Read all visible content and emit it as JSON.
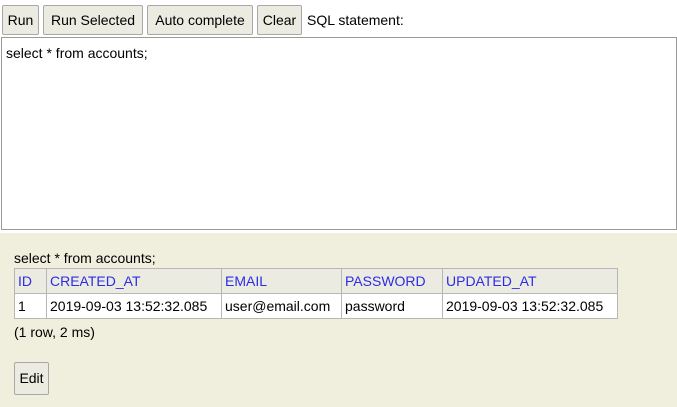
{
  "toolbar": {
    "run_label": "Run",
    "run_selected_label": "Run Selected",
    "auto_complete_label": "Auto complete",
    "clear_label": "Clear",
    "sql_statement_label": "SQL statement:"
  },
  "editor": {
    "sql_text": "select * from accounts;"
  },
  "results": {
    "query_echo": "select * from accounts;",
    "columns": [
      "ID",
      "CREATED_AT",
      "EMAIL",
      "PASSWORD",
      "UPDATED_AT"
    ],
    "rows": [
      [
        "1",
        "2019-09-03 13:52:32.085",
        "user@email.com",
        "password",
        "2019-09-03 13:52:32.085"
      ]
    ],
    "row_count_text": "(1 row, 2 ms)",
    "edit_label": "Edit",
    "header_link_color": "#2c2ce8",
    "pane_background": "#f0eedd"
  }
}
